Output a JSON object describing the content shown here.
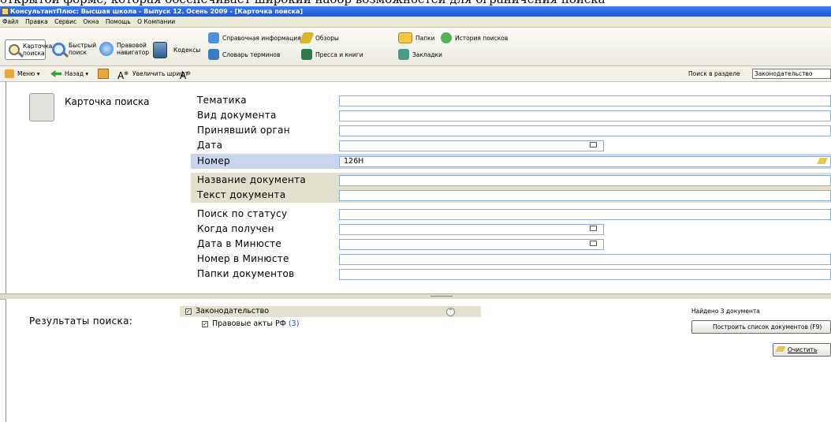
{
  "window": {
    "cut_text": "открытой форме, которая обеспечивает широкий набор возможностей для ограничения поиска",
    "title": "КонсультантПлюс: Высшая школа - Выпуск 12. Осень 2009 - [Карточка поиска]"
  },
  "menu": [
    "Файл",
    "Правка",
    "Сервис",
    "Окна",
    "Помощь",
    "О Компании"
  ],
  "ribbon": {
    "card_search": "Карточка поиска",
    "quick_search": "Быстрый поиск",
    "legal_navigator": "Правовой навигатор",
    "codes": "Кодексы",
    "reference_info": "Справочная информация",
    "reviews": "Обзоры",
    "folders": "Папки",
    "search_history": "История поисков",
    "terms_dictionary": "Словарь терминов",
    "press_books": "Пресса и книги",
    "bookmarks": "Закладки"
  },
  "nav": {
    "menu": "Меню",
    "back": "Назад",
    "increase_font": "Увеличить шрифт",
    "search_in_section_label": "Поиск в разделе",
    "search_in_section_value": "Законодательство"
  },
  "card": {
    "label": "Карточка поиска",
    "fields": [
      {
        "label": "Тематика",
        "value": ""
      },
      {
        "label": "Вид документа",
        "value": ""
      },
      {
        "label": "Принявший орган",
        "value": ""
      },
      {
        "label": "Дата",
        "value": ""
      },
      {
        "label": "Номер",
        "value": "126Н"
      },
      {
        "label": "Название документа",
        "value": ""
      },
      {
        "label": "Текст документа",
        "value": ""
      },
      {
        "label": "Поиск по статусу",
        "value": ""
      },
      {
        "label": "Когда получен",
        "value": ""
      },
      {
        "label": "Дата в Минюсте",
        "value": ""
      },
      {
        "label": "Номер в Минюсте",
        "value": ""
      },
      {
        "label": "Папки документов",
        "value": ""
      }
    ]
  },
  "results": {
    "label": "Результаты поиска:",
    "tree_root": "Законодательство",
    "tree_child": "Правовые акты РФ",
    "tree_child_count": "(3)",
    "found_text": "Найдено 3 документа",
    "build_list_button": "Построить список документов (F9)",
    "clear_button": "Очистить"
  },
  "colors": {
    "title_bar": "#2a62dc",
    "highlight_row": "#c9d4ee",
    "gray_row": "#e2dfcc",
    "link_blue": "#3050c8"
  }
}
